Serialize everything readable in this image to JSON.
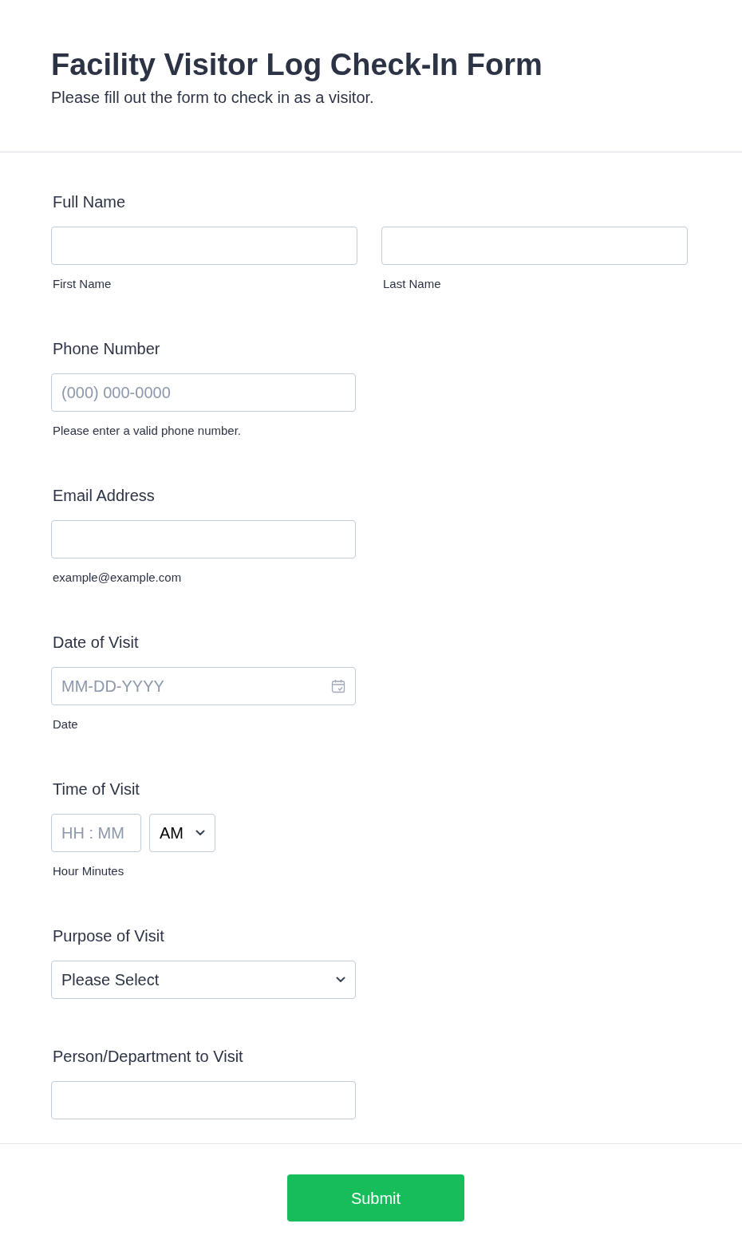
{
  "header": {
    "title": "Facility Visitor Log Check-In Form",
    "subtitle": "Please fill out the form to check in as a visitor."
  },
  "fields": [
    {
      "kind": "name",
      "label": "Full Name",
      "parts": [
        {
          "sublabel": "First Name"
        },
        {
          "sublabel": "Last Name"
        }
      ]
    },
    {
      "kind": "text",
      "label": "Phone Number",
      "placeholder": "(000) 000-0000",
      "sublabel": "Please enter a valid phone number."
    },
    {
      "kind": "text",
      "label": "Email Address",
      "sublabel": "example@example.com"
    },
    {
      "kind": "date",
      "label": "Date of Visit",
      "placeholder": "MM-DD-YYYY",
      "sublabel": "Date"
    },
    {
      "kind": "time",
      "label": "Time of Visit",
      "placeholder": "HH : MM",
      "value": "AM",
      "sublabel": "Hour Minutes"
    },
    {
      "kind": "select",
      "label": "Purpose of Visit",
      "value": "Please Select"
    },
    {
      "kind": "text",
      "label": "Person/Department to Visit"
    }
  ],
  "submit": "Submit"
}
